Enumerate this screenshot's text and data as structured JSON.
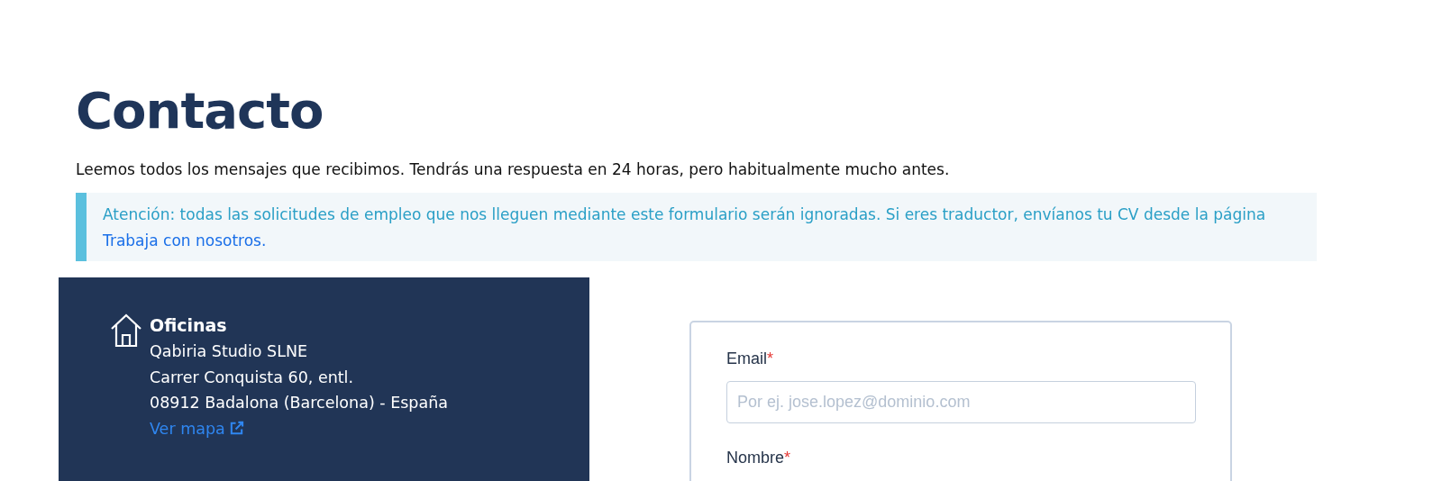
{
  "title": "Contacto",
  "intro": "Leemos todos los mensajes que recibimos. Tendrás una respuesta en 24 horas, pero habitualmente mucho antes.",
  "notice": {
    "text": "Atención: todas las solicitudes de empleo que nos lleguen mediante este formulario serán ignoradas. Si eres traductor, envíanos tu CV desde la página ",
    "link": "Trabaja con nosotros."
  },
  "offices": {
    "heading": "Oficinas",
    "lines": [
      "Qabiria Studio SLNE",
      "Carrer Conquista 60, entl.",
      "08912 Badalona (Barcelona) - España"
    ],
    "map_link": "Ver mapa"
  },
  "form": {
    "required_mark": "*",
    "fields": [
      {
        "label": "Email",
        "required": true,
        "placeholder": "Por ej. jose.lopez@dominio.com"
      },
      {
        "label": "Nombre",
        "required": true
      }
    ]
  }
}
